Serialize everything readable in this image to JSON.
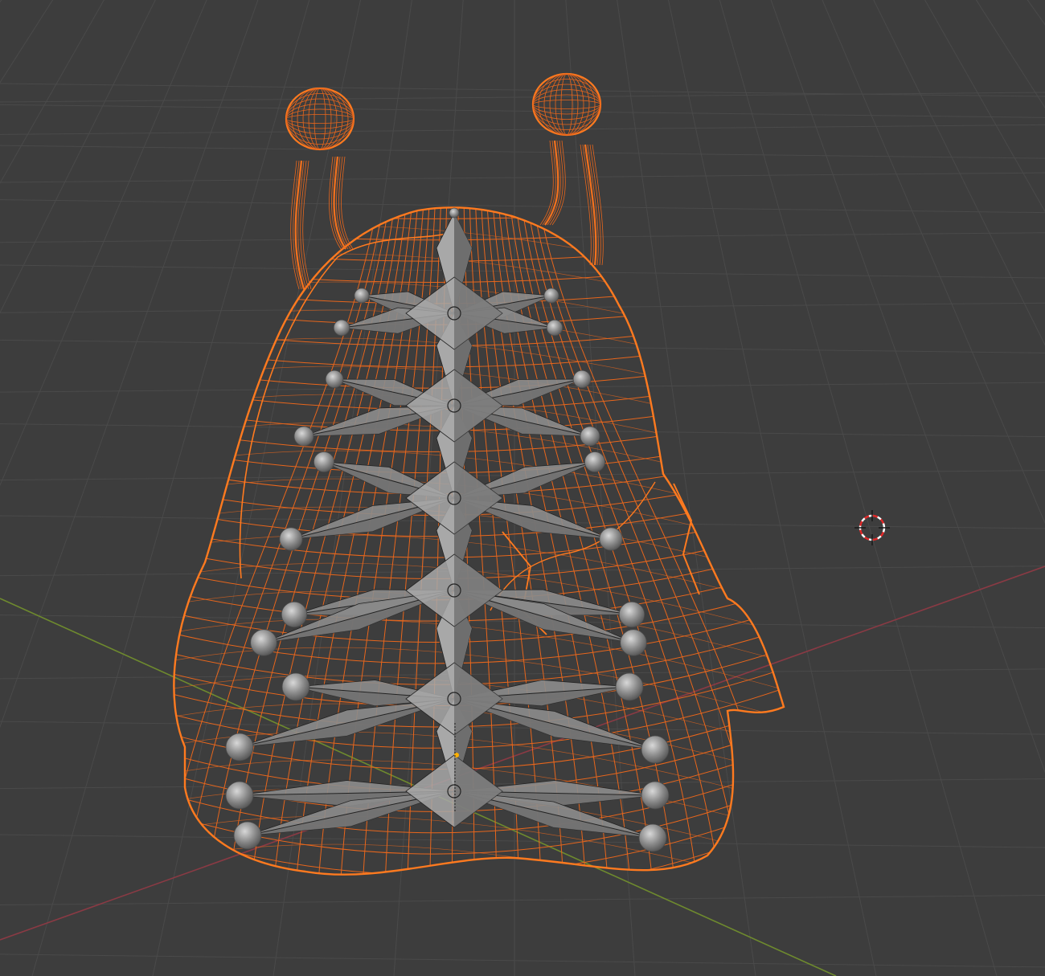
{
  "viewport": {
    "background": "#3d3d3d",
    "grid_color": "#4a4a4a",
    "axis_x_color": "#8a3a44",
    "axis_y_color": "#6e8a2e"
  },
  "mesh": {
    "object": "snail-body",
    "wire_color": "#e8661c",
    "outline_color": "#ff7a1f"
  },
  "armature": {
    "bone_fill": "#8c8c8c",
    "bone_dark": "#6e6e6e",
    "bone_light": "#a8a8a8",
    "joint_color": "#9a9a9a",
    "line_color": "#222222"
  },
  "cursor": {
    "icon": "3d-cursor-icon",
    "ring_red": "#e02828",
    "ring_white": "#ffffff"
  }
}
